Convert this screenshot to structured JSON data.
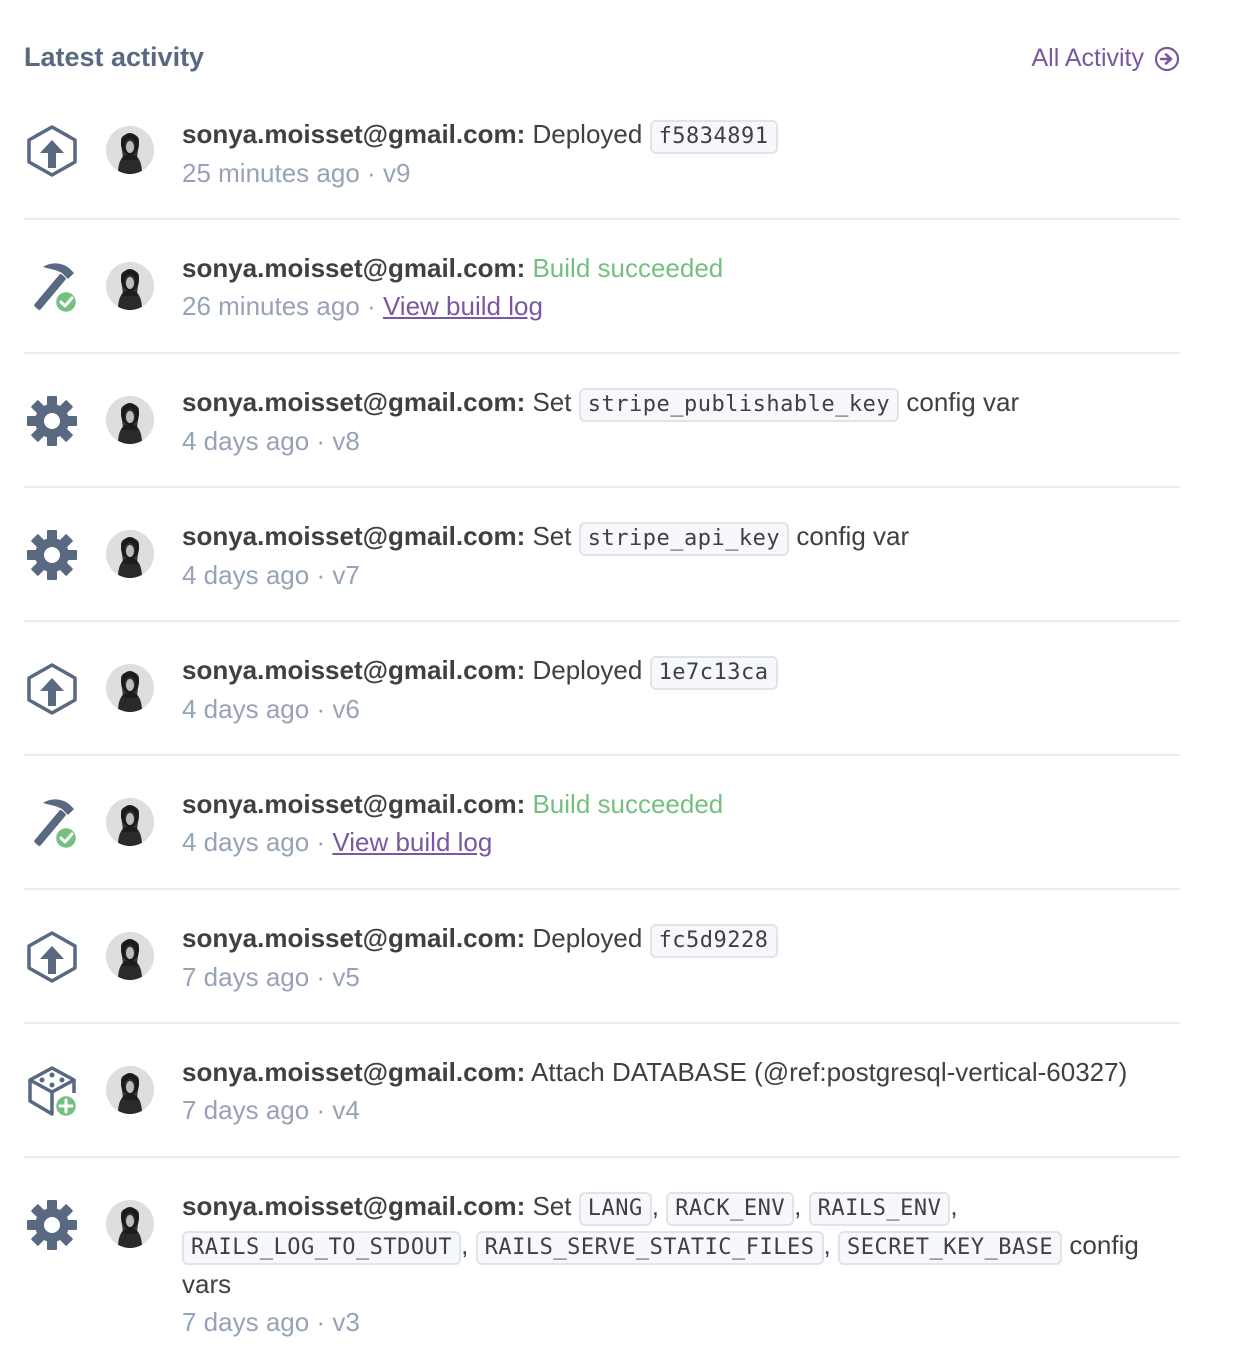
{
  "header": {
    "title": "Latest activity",
    "all_activity_label": "All Activity"
  },
  "colors": {
    "accent": "#79589f",
    "success": "#74c080",
    "muted": "#96a3b6",
    "icon": "#596981"
  },
  "activities": [
    {
      "icon": "deploy-icon",
      "actor": "sonya.moisset@gmail.com:",
      "action": "Deployed",
      "code": "f5834891",
      "meta_time": "25 minutes ago",
      "meta_sep": "·",
      "meta_version": "v9"
    },
    {
      "icon": "build-success-icon",
      "actor": "sonya.moisset@gmail.com:",
      "action": "Build succeeded",
      "meta_time": "26 minutes ago",
      "meta_sep": "·",
      "meta_link": "View build log"
    },
    {
      "icon": "gear-icon",
      "actor": "sonya.moisset@gmail.com:",
      "action": "Set",
      "code": "stripe_publishable_key",
      "suffix": "config var",
      "meta_time": "4 days ago",
      "meta_sep": "·",
      "meta_version": "v8"
    },
    {
      "icon": "gear-icon",
      "actor": "sonya.moisset@gmail.com:",
      "action": "Set",
      "code": "stripe_api_key",
      "suffix": "config var",
      "meta_time": "4 days ago",
      "meta_sep": "·",
      "meta_version": "v7"
    },
    {
      "icon": "deploy-icon",
      "actor": "sonya.moisset@gmail.com:",
      "action": "Deployed",
      "code": "1e7c13ca",
      "meta_time": "4 days ago",
      "meta_sep": "·",
      "meta_version": "v6"
    },
    {
      "icon": "build-success-icon",
      "actor": "sonya.moisset@gmail.com:",
      "action": "Build succeeded",
      "meta_time": "4 days ago",
      "meta_sep": "·",
      "meta_link": "View build log"
    },
    {
      "icon": "deploy-icon",
      "actor": "sonya.moisset@gmail.com:",
      "action": "Deployed",
      "code": "fc5d9228",
      "meta_time": "7 days ago",
      "meta_sep": "·",
      "meta_version": "v5"
    },
    {
      "icon": "addon-attach-icon",
      "actor": "sonya.moisset@gmail.com:",
      "action": "Attach DATABASE (@ref:postgresql-vertical-60327)",
      "meta_time": "7 days ago",
      "meta_sep": "·",
      "meta_version": "v4"
    },
    {
      "icon": "gear-icon",
      "actor": "sonya.moisset@gmail.com:",
      "action": "Set",
      "codes": [
        "LANG",
        "RACK_ENV",
        "RAILS_ENV",
        "RAILS_LOG_TO_STDOUT",
        "RAILS_SERVE_STATIC_FILES",
        "SECRET_KEY_BASE"
      ],
      "code_separator": ",",
      "suffix_1": "config",
      "suffix_2": "vars",
      "meta_time": "7 days ago",
      "meta_sep": "·",
      "meta_version": "v3"
    }
  ]
}
